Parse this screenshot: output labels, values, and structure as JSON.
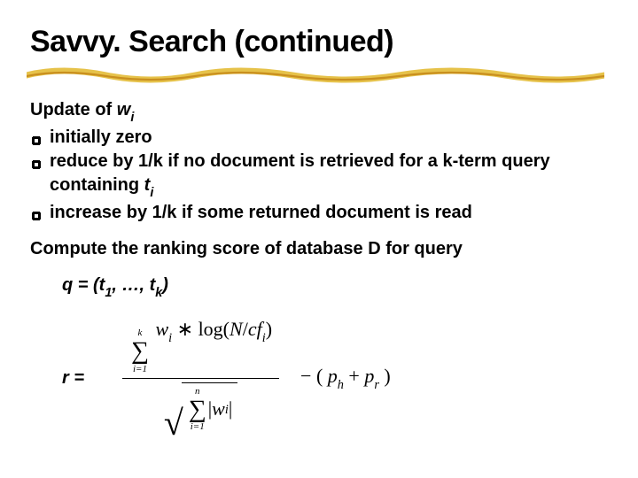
{
  "title": "Savvy. Search (continued)",
  "update_heading_pre": "Update of ",
  "update_var": "w",
  "update_sub": "i",
  "bullets": {
    "b1": "initially zero",
    "b2_pre": "reduce by 1/k if no document is retrieved for a k-term query containing ",
    "b2_var": "t",
    "b2_sub": "i",
    "b3": "increase by 1/k if some returned document is read"
  },
  "compute_line": "Compute the ranking score of database D for query",
  "q_pre": "q = (t",
  "q_sub1": "1",
  "q_mid": ", …, t",
  "q_sub2": "k",
  "q_post": ")",
  "r_label": "r =",
  "formula": {
    "sum_upper": "k",
    "sum_lower": "i=1",
    "num_w": "w",
    "num_wi": "i",
    "num_log_pre": " ∗ log(",
    "num_N": "N",
    "num_slash": "/",
    "num_cf": "cf",
    "num_cfi": "i",
    "num_log_post": ")",
    "den_sum_upper": "n",
    "den_sum_lower": "i=1",
    "den_bar1": "| ",
    "den_w": "w",
    "den_wi": "i",
    "den_bar2": " |",
    "tail_pre": "− ( ",
    "tail_ph": "p",
    "tail_phs": "h",
    "tail_plus": " + ",
    "tail_pr": "p",
    "tail_prs": "r",
    "tail_post": " )"
  }
}
